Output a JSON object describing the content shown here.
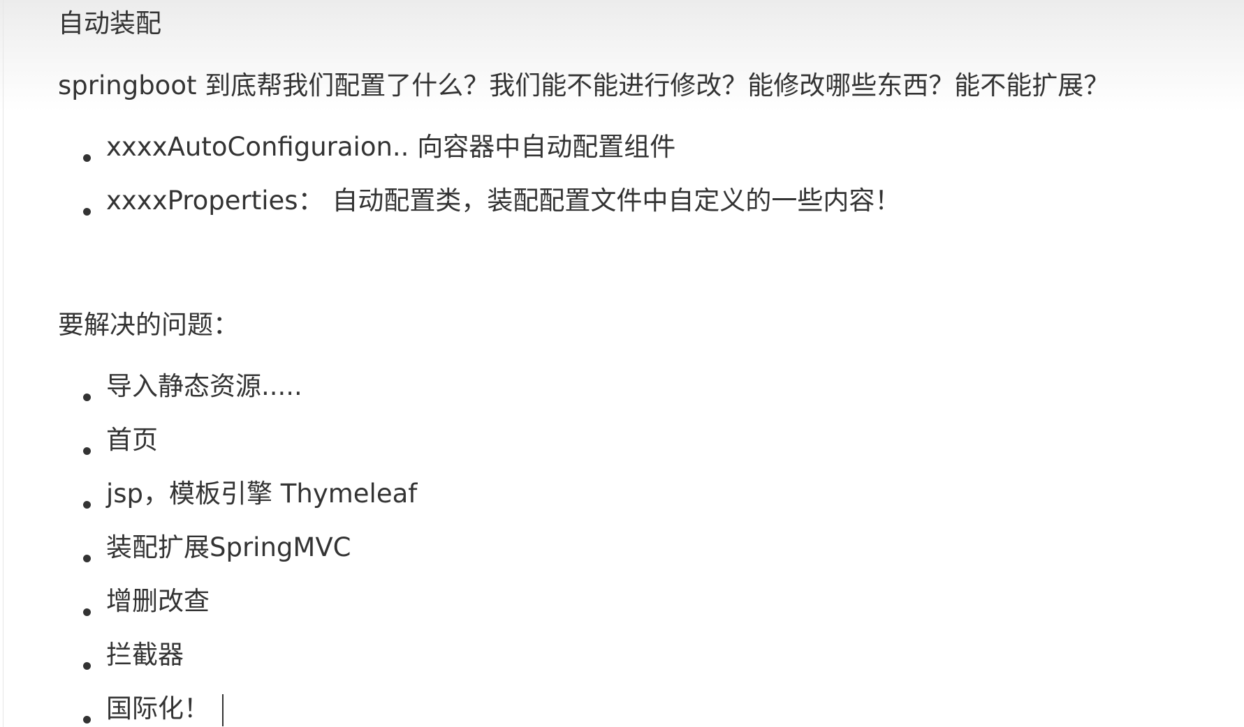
{
  "document": {
    "heading": "自动装配",
    "question": "springboot 到底帮我们配置了什么？我们能不能进行修改？能修改哪些东西？能不能扩展？",
    "intro_items": [
      "xxxxAutoConfiguraion.. 向容器中自动配置组件",
      "xxxxProperties： 自动配置类，装配配置文件中自定义的一些内容！"
    ],
    "problems_heading": "要解决的问题：",
    "problem_items": [
      "导入静态资源.....",
      "首页",
      "jsp，模板引擎 Thymeleaf",
      "装配扩展SpringMVC",
      "增删改查",
      "拦截器",
      "国际化！"
    ]
  }
}
